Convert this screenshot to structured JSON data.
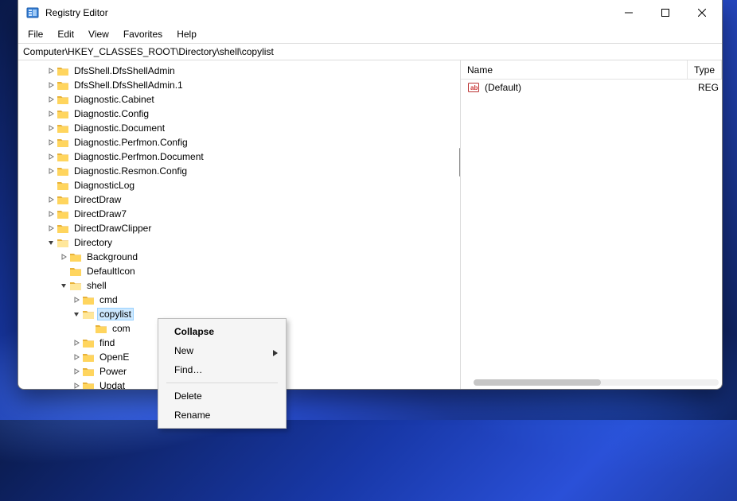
{
  "window": {
    "title": "Registry Editor",
    "address": "Computer\\HKEY_CLASSES_ROOT\\Directory\\shell\\copylist"
  },
  "menus": {
    "file": "File",
    "edit": "Edit",
    "view": "View",
    "favorites": "Favorites",
    "help": "Help"
  },
  "tree": {
    "items": [
      {
        "label": "DfsShell.DfsShellAdmin",
        "expand": "closed",
        "depth": 0
      },
      {
        "label": "DfsShell.DfsShellAdmin.1",
        "expand": "closed",
        "depth": 0
      },
      {
        "label": "Diagnostic.Cabinet",
        "expand": "closed",
        "depth": 0
      },
      {
        "label": "Diagnostic.Config",
        "expand": "closed",
        "depth": 0
      },
      {
        "label": "Diagnostic.Document",
        "expand": "closed",
        "depth": 0
      },
      {
        "label": "Diagnostic.Perfmon.Config",
        "expand": "closed",
        "depth": 0
      },
      {
        "label": "Diagnostic.Perfmon.Document",
        "expand": "closed",
        "depth": 0
      },
      {
        "label": "Diagnostic.Resmon.Config",
        "expand": "closed",
        "depth": 0
      },
      {
        "label": "DiagnosticLog",
        "expand": "none",
        "depth": 0
      },
      {
        "label": "DirectDraw",
        "expand": "closed",
        "depth": 0
      },
      {
        "label": "DirectDraw7",
        "expand": "closed",
        "depth": 0
      },
      {
        "label": "DirectDrawClipper",
        "expand": "closed",
        "depth": 0
      },
      {
        "label": "Directory",
        "expand": "open",
        "depth": 0
      },
      {
        "label": "Background",
        "expand": "closed",
        "depth": 1
      },
      {
        "label": "DefaultIcon",
        "expand": "none",
        "depth": 1
      },
      {
        "label": "shell",
        "expand": "open",
        "depth": 1
      },
      {
        "label": "cmd",
        "expand": "closed",
        "depth": 2
      },
      {
        "label": "copylist",
        "expand": "open",
        "depth": 2,
        "selected": true
      },
      {
        "label": "com",
        "expand": "none",
        "depth": 3,
        "truncated": true
      },
      {
        "label": "find",
        "expand": "closed",
        "depth": 2
      },
      {
        "label": "OpenE",
        "expand": "closed",
        "depth": 2,
        "truncated": true
      },
      {
        "label": "Power",
        "expand": "closed",
        "depth": 2,
        "truncated": true
      },
      {
        "label": "Updat",
        "expand": "closed",
        "depth": 2,
        "truncated": true
      }
    ]
  },
  "list": {
    "columns": {
      "name": "Name",
      "type": "Type"
    },
    "rows": [
      {
        "name": "(Default)",
        "type": "REG",
        "icon": "string-value-icon"
      }
    ]
  },
  "context_menu": {
    "items": [
      {
        "label": "Collapse",
        "bold": true
      },
      {
        "label": "New",
        "submenu": true
      },
      {
        "label": "Find…"
      },
      {
        "sep": true
      },
      {
        "label": "Delete"
      },
      {
        "label": "Rename"
      }
    ]
  }
}
